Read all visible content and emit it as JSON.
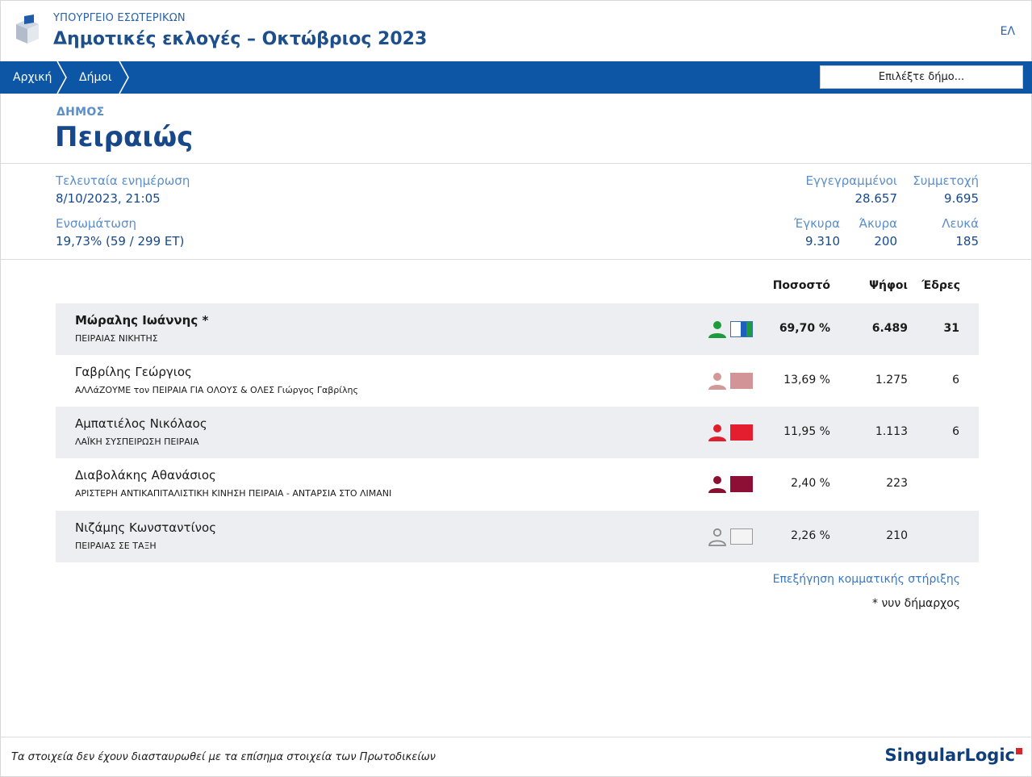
{
  "header": {
    "ministry": "ΥΠΟΥΡΓΕΙΟ ΕΣΩΤΕΡΙΚΩΝ",
    "title": "Δημοτικές εκλογές – Οκτώβριος 2023",
    "language": "ΕΛ",
    "logo_icon": "ballot-box-icon"
  },
  "nav": {
    "breadcrumbs": [
      "Αρχική",
      "Δήμοι"
    ],
    "select_placeholder": "Επιλέξτε δήμο..."
  },
  "municipality": {
    "label": "ΔΗΜΟΣ",
    "name": "Πειραιώς"
  },
  "stats": {
    "last_update_label": "Τελευταία ενημέρωση",
    "last_update_value": "8/10/2023, 21:05",
    "integration_label": "Ενσωμάτωση",
    "integration_value": "19,73% (59 / 299 ΕΤ)",
    "registered_label": "Εγγεγραμμένοι",
    "registered_value": "28.657",
    "turnout_label": "Συμμετοχή",
    "turnout_value": "9.695",
    "valid_label": "Έγκυρα",
    "valid_value": "9.310",
    "invalid_label": "Άκυρα",
    "invalid_value": "200",
    "blank_label": "Λευκά",
    "blank_value": "185"
  },
  "table": {
    "headers": {
      "percent": "Ποσοστό",
      "votes": "Ψήφοι",
      "seats": "Έδρες"
    },
    "rows": [
      {
        "candidate": "Μώραλης Ιωάννης *",
        "party": "ΠΕΙΡΑΙΑΣ ΝΙΚΗΤΗΣ",
        "percent": "69,70 %",
        "votes": "6.489",
        "seats": "31",
        "icon_color": "#1c9c3a",
        "swatch": "white-blue-green",
        "bold": true
      },
      {
        "candidate": "Γαβρίλης Γεώργιος",
        "party": "ΑΛΛάΖΟΥΜΕ τον ΠΕΙΡΑΙΑ ΓΙΑ ΟΛΟΥΣ & ΟΛΕΣ Γιώργος Γαβρίλης",
        "percent": "13,69 %",
        "votes": "1.275",
        "seats": "6",
        "icon_color": "#d39999",
        "swatch_color": "#d39497"
      },
      {
        "candidate": "Αμπατιέλος Νικόλαος",
        "party": "ΛΑΪΚΗ ΣΥΣΠΕΙΡΩΣΗ ΠΕΙΡΑΙΑ",
        "percent": "11,95 %",
        "votes": "1.113",
        "seats": "6",
        "icon_color": "#e01f2d",
        "swatch_color": "#e41e2e"
      },
      {
        "candidate": "Διαβολάκης Αθανάσιος",
        "party": "ΑΡΙΣΤΕΡΗ ΑΝΤΙΚΑΠΙΤΑΛΙΣΤΙΚΗ ΚΙΝΗΣΗ ΠΕΙΡΑΙΑ - ΑΝΤΑΡΣΙΑ ΣΤΟ ΛΙΜΑΝΙ",
        "percent": "2,40 %",
        "votes": "223",
        "seats": "",
        "icon_color": "#8a1030",
        "swatch_color": "#8e0f35"
      },
      {
        "candidate": "Νιζάμης Κωνσταντίνος",
        "party": "ΠΕΙΡΑΙΑΣ ΣΕ ΤΑΞΗ",
        "percent": "2,26 %",
        "votes": "210",
        "seats": "",
        "icon_color": "#8a8a8a",
        "swatch_color": "#f4f4f4"
      }
    ]
  },
  "explain_link": "Επεξήγηση κομματικής στήριξης",
  "footnote": "* νυν δήμαρχος",
  "footer": {
    "disclaimer": "Τα στοιχεία δεν έχουν διασταυρωθεί με τα επίσημα στοιχεία των Πρωτοδικείων",
    "brand_a": "Singular",
    "brand_b": "Logic"
  }
}
